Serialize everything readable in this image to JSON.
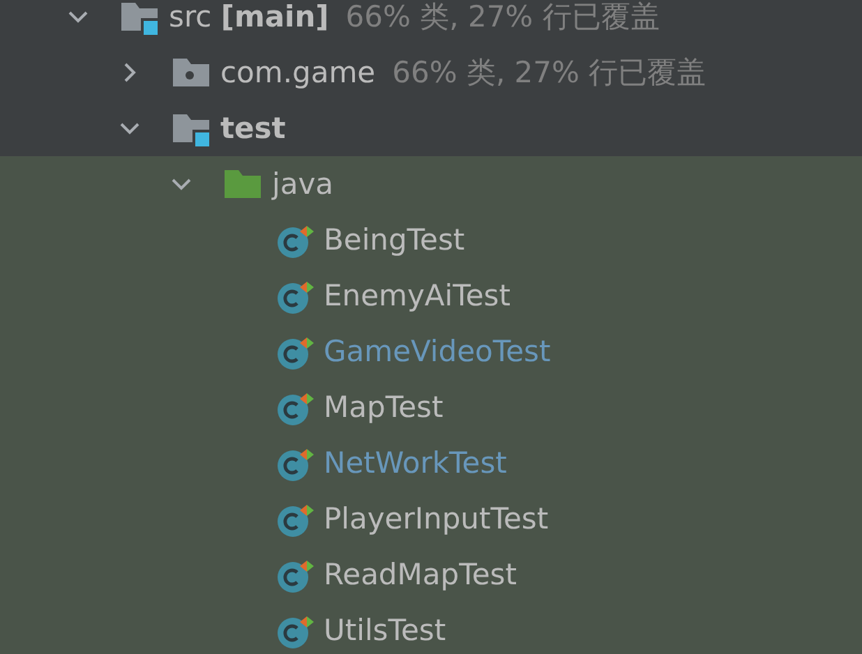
{
  "tree": [
    {
      "label": "src **[main]**",
      "kind": "source-root",
      "coverage": "66% 类, 27% 行已覆盖",
      "expanded": true,
      "highlighted": false,
      "children": [
        {
          "label": "com.game",
          "kind": "package",
          "coverage": "66% 类, 27% 行已覆盖",
          "expanded": false,
          "highlighted": false
        },
        {
          "label": "test",
          "kind": "test-root",
          "bold": true,
          "expanded": true,
          "highlighted": false,
          "children": [
            {
              "label": "java",
              "kind": "test-folder",
              "expanded": true,
              "highlighted": true,
              "children": [
                {
                  "label": "BeingTest",
                  "kind": "test-class",
                  "changed": false
                },
                {
                  "label": "EnemyAiTest",
                  "kind": "test-class",
                  "changed": false
                },
                {
                  "label": "GameVideoTest",
                  "kind": "test-class",
                  "changed": true
                },
                {
                  "label": "MapTest",
                  "kind": "test-class",
                  "changed": false
                },
                {
                  "label": "NetWorkTest",
                  "kind": "test-class",
                  "changed": true
                },
                {
                  "label": "PlayerInputTest",
                  "kind": "test-class",
                  "changed": false
                },
                {
                  "label": "ReadMapTest",
                  "kind": "test-class",
                  "changed": false
                },
                {
                  "label": "UtilsTest",
                  "kind": "test-class",
                  "changed": false
                }
              ]
            }
          ]
        }
      ]
    }
  ]
}
